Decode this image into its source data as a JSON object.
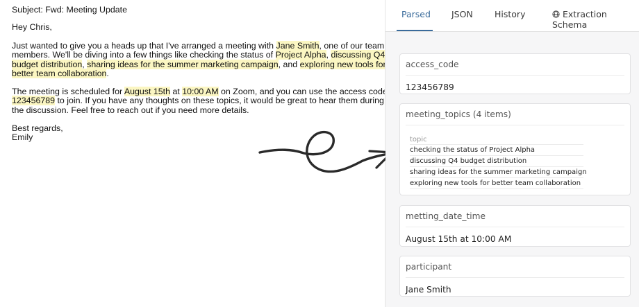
{
  "email": {
    "subject": "Subject: Fwd: Meeting Update",
    "greeting": "Hey Chris,",
    "p1": {
      "l1_a": "Just wanted to give you a heads up that I've arranged a meeting with ",
      "l1_hl": "Jane Smith",
      "l1_b": ", one of our team",
      "l2_a": "members. We'll be diving into a few things like checking the status of ",
      "l2_hl1": "Project Alpha",
      "l2_sep": ", ",
      "l2_hl2": "discussing Q4",
      "l3_hl1": "budget distribution",
      "l3_sep1": ", ",
      "l3_hl2": "sharing ideas for the summer marketing campaign",
      "l3_sep2": ", and ",
      "l3_hl3": "exploring new tools for",
      "l4_hl": "better team collaboration",
      "l4_end": "."
    },
    "p2": {
      "l1_a": "The meeting is scheduled for ",
      "l1_hl1": "August 15th",
      "l1_b": " at ",
      "l1_hl2": "10:00 AM",
      "l1_c": " on Zoom, and you can use the access code",
      "l2_hl": "123456789",
      "l2_a": " to join. If you have any thoughts on these topics, it would be great to hear them during",
      "l3": "the discussion. Feel free to reach out if you need more details."
    },
    "closing": "Best regards,",
    "signature": "Emily"
  },
  "tabs": {
    "parsed": "Parsed",
    "json": "JSON",
    "history": "History",
    "schema": "Extraction Schema"
  },
  "fields": {
    "access_code": {
      "label": "access_code",
      "value": "123456789"
    },
    "meeting_topics": {
      "label": "meeting_topics (4 items)",
      "column": "topic",
      "items": [
        "checking the status of Project Alpha",
        "discussing Q4 budget distribution",
        "sharing ideas for the summer marketing campaign",
        "exploring new tools for better team collaboration"
      ]
    },
    "meeting_date_time": {
      "label": "metting_date_time",
      "value": "August 15th at 10:00 AM"
    },
    "participant": {
      "label": "participant",
      "value": "Jane Smith"
    }
  },
  "colors": {
    "highlight": "#fbf6c2",
    "accent": "#3a6b9b",
    "pane_background": "#f6f6f7"
  },
  "icons": [
    "schema-globe-icon",
    "arrow-icon"
  ]
}
